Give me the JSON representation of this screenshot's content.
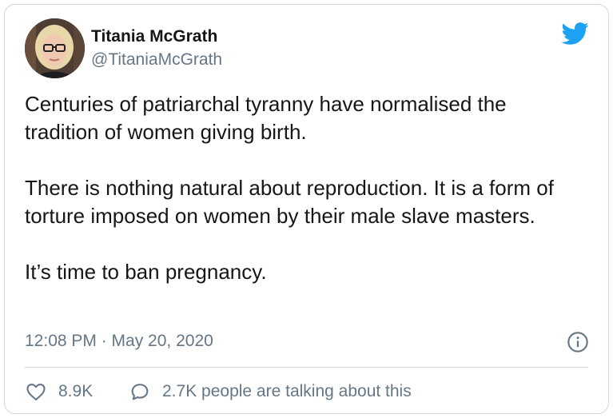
{
  "author": {
    "name": "Titania McGrath",
    "handle": "@TitaniaMcGrath"
  },
  "tweet": {
    "paragraphs": [
      "Centuries of patriarchal tyranny have normalised the tradition of women giving birth.",
      "There is nothing natural about reproduction. It is a form of torture imposed on women by their male slave masters.",
      "It’s time to ban pregnancy."
    ],
    "timestamp": "12:08 PM · May 20, 2020"
  },
  "actions": {
    "likes": "8.9K",
    "talking": "2.7K people are talking about this"
  },
  "icons": {
    "brand": "twitter-bird-icon",
    "info": "info-icon",
    "like": "heart-icon",
    "reply": "speech-bubble-icon"
  },
  "colors": {
    "twitter_blue": "#1da1f2",
    "text": "#14171a",
    "secondary": "#657786",
    "border": "#cfd9de"
  }
}
